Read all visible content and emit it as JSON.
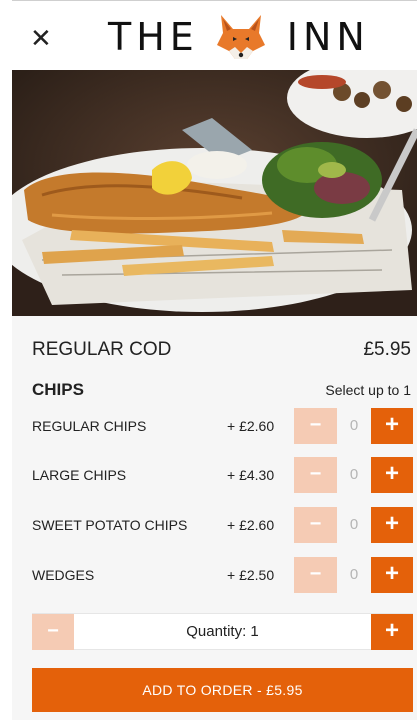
{
  "header": {
    "close_icon": "close-icon",
    "brand_left": "THE",
    "brand_right": "INN",
    "brand_logo": "fox-logo"
  },
  "hero": {
    "image": "fish-and-chips-photo"
  },
  "item": {
    "name": "REGULAR COD",
    "price": "£5.95"
  },
  "section": {
    "title": "CHIPS",
    "hint": "Select up to 1"
  },
  "options": [
    {
      "label": "REGULAR CHIPS",
      "price": "+ £2.60",
      "count": "0",
      "minus": "−",
      "plus": "+"
    },
    {
      "label": "LARGE CHIPS",
      "price": "+ £4.30",
      "count": "0",
      "minus": "−",
      "plus": "+"
    },
    {
      "label": "SWEET POTATO CHIPS",
      "price": "+ £2.60",
      "count": "0",
      "minus": "−",
      "plus": "+"
    },
    {
      "label": "WEDGES",
      "price": "+ £2.50",
      "count": "0",
      "minus": "−",
      "plus": "+"
    }
  ],
  "quantity": {
    "text": "Quantity:  1",
    "minus": "−",
    "plus": "+"
  },
  "cta": {
    "label": "ADD TO ORDER  -  £5.95"
  },
  "colors": {
    "accent": "#e4610a",
    "accent_disabled": "#f5cbb4",
    "panel_bg": "#f6f6f6"
  }
}
